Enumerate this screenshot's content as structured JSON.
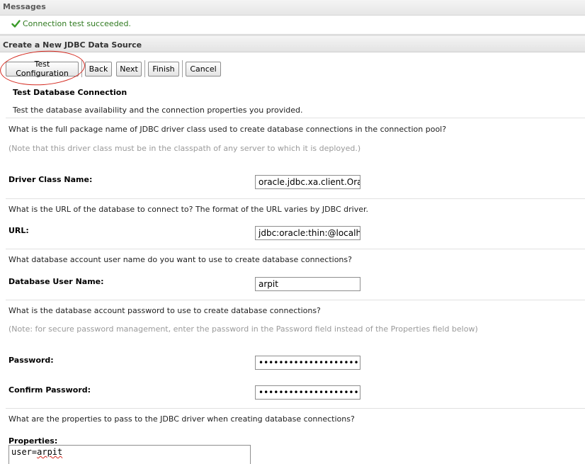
{
  "messages": {
    "title": "Messages",
    "success_text": "Connection test succeeded."
  },
  "section": {
    "title": "Create a New JDBC Data Source"
  },
  "toolbar": {
    "test_configuration": "Test Configuration",
    "back": "Back",
    "next": "Next",
    "finish": "Finish",
    "cancel": "Cancel"
  },
  "form": {
    "heading": "Test Database Connection",
    "intro": "Test the database availability and the connection properties you provided.",
    "driver_question": "What is the full package name of JDBC driver class used to create database connections in the connection pool?",
    "driver_note": "(Note that this driver class must be in the classpath of any server to which it is deployed.)",
    "driver_label": "Driver Class Name:",
    "driver_value": "oracle.jdbc.xa.client.Ora",
    "url_question": "What is the URL of the database to connect to? The format of the URL varies by JDBC driver.",
    "url_label": "URL:",
    "url_value": "jdbc:oracle:thin:@localh",
    "user_question": "What database account user name do you want to use to create database connections?",
    "user_label": "Database User Name:",
    "user_value": "arpit",
    "password_question": "What is the database account password to use to create database connections?",
    "password_note": "(Note: for secure password management, enter the password in the Password field instead of the Properties field below)",
    "password_label": "Password:",
    "password_value": "••••••••••••••••••••",
    "confirm_label": "Confirm Password:",
    "confirm_value": "••••••••••••••••••••",
    "properties_question": "What are the properties to pass to the JDBC driver when creating database connections?",
    "properties_label": "Properties:",
    "properties_key": "user=",
    "properties_val": "arpit"
  },
  "icons": {
    "success": "check-icon"
  },
  "colors": {
    "success_text": "#2f7a1f",
    "annotation_red": "#d4281e"
  }
}
